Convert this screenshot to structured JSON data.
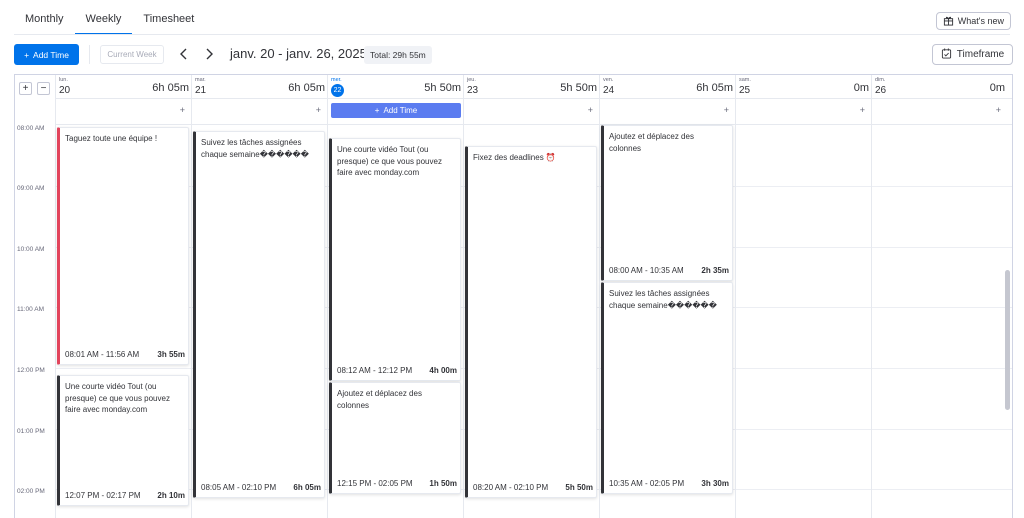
{
  "tabs": [
    "Monthly",
    "Weekly",
    "Timesheet"
  ],
  "whats_new": "What's new",
  "toolbar": {
    "add_time": "Add Time",
    "current_week": "Current Week",
    "date_range": "janv. 20 - janv. 26, 2025",
    "total": "Total:  29h 55m",
    "timeframe": "Timeframe"
  },
  "hours": [
    "08:00 AM",
    "09:00 AM",
    "10:00 AM",
    "11:00 AM",
    "12:00 PM",
    "01:00 PM",
    "02:00 PM"
  ],
  "days": [
    {
      "abbr": "lun.",
      "num": "20",
      "total": "6h 05m"
    },
    {
      "abbr": "mar.",
      "num": "21",
      "total": "6h 05m"
    },
    {
      "abbr": "mer.",
      "num": "22",
      "total": "5h 50m",
      "today": true
    },
    {
      "abbr": "jeu.",
      "num": "23",
      "total": "5h 50m"
    },
    {
      "abbr": "ven.",
      "num": "24",
      "total": "6h 05m"
    },
    {
      "abbr": "sam.",
      "num": "25",
      "total": "0m"
    },
    {
      "abbr": "dim.",
      "num": "26",
      "total": "0m"
    }
  ],
  "inline_add_time": "Add Time",
  "events": [
    {
      "title": "Taguez toute une équipe !",
      "time": "08:01 AM - 11:56 AM",
      "duration": "3h 55m",
      "accent": "pink"
    },
    {
      "title": "Une courte vidéo Tout (ou presque) ce que vous pouvez faire avec monday.com",
      "time": "12:07 PM - 02:17 PM",
      "duration": "2h 10m"
    },
    {
      "title": "Suivez les tâches assignées chaque semaine������",
      "time": "08:05 AM - 02:10 PM",
      "duration": "6h 05m"
    },
    {
      "title": "Une courte vidéo Tout (ou presque) ce que vous pouvez faire avec monday.com",
      "time": "08:12 AM - 12:12 PM",
      "duration": "4h 00m"
    },
    {
      "title": "Ajoutez et déplacez des colonnes",
      "time": "12:15 PM - 02:05 PM",
      "duration": "1h 50m"
    },
    {
      "title": "Fixez des deadlines ⏰",
      "time": "08:20 AM - 02:10 PM",
      "duration": "5h 50m"
    },
    {
      "title": "Ajoutez et déplacez des colonnes",
      "time": "08:00 AM - 10:35 AM",
      "duration": "2h 35m"
    },
    {
      "title": "Suivez les tâches assignées chaque semaine������",
      "time": "10:35 AM - 02:05 PM",
      "duration": "3h 30m"
    }
  ],
  "colors": {
    "accent": "#0073ea",
    "pink": "#e2445c",
    "event_bar": "#323338"
  }
}
